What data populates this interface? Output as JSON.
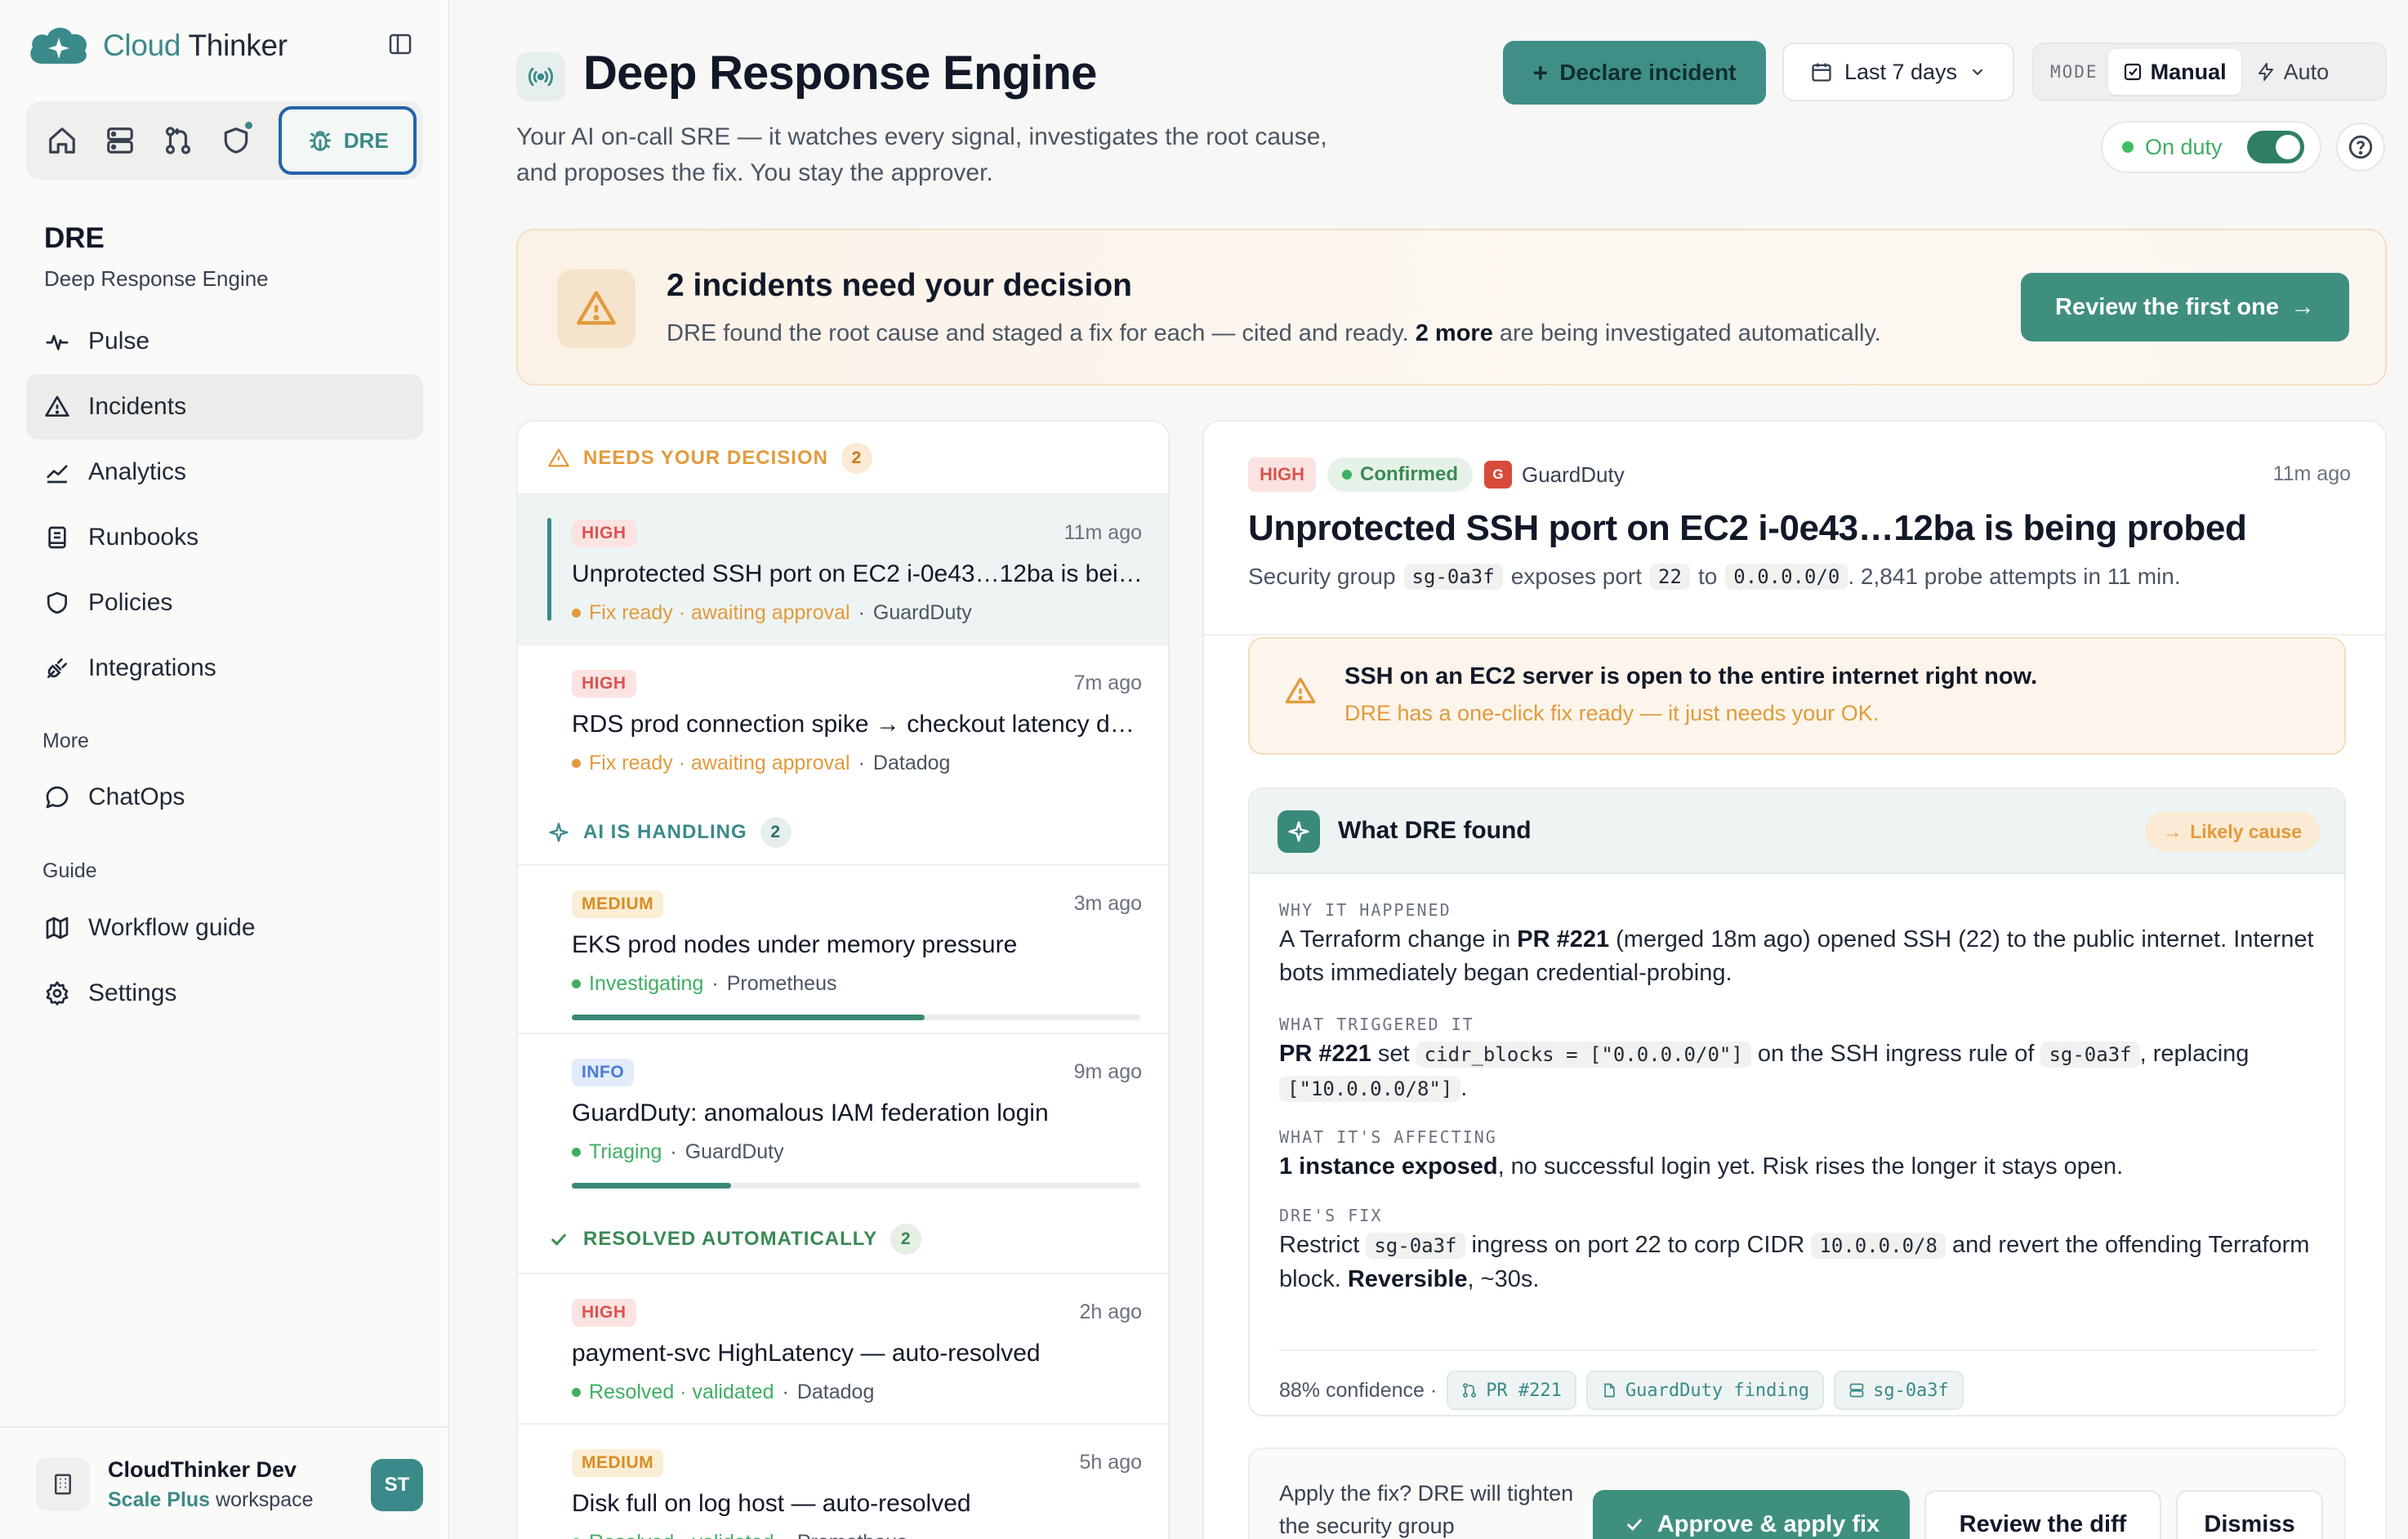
{
  "brand": {
    "part1": "Cloud",
    "part2": " Thinker"
  },
  "sidebar": {
    "dre_label": "DRE",
    "title": "DRE",
    "subtitle": "Deep Response Engine",
    "nav": [
      {
        "label": "Pulse",
        "icon": "pulse-icon"
      },
      {
        "label": "Incidents",
        "icon": "alert-triangle-icon",
        "active": true
      },
      {
        "label": "Analytics",
        "icon": "chart-icon"
      },
      {
        "label": "Runbooks",
        "icon": "book-icon"
      },
      {
        "label": "Policies",
        "icon": "shield-icon"
      },
      {
        "label": "Integrations",
        "icon": "plug-icon"
      }
    ],
    "more_label": "More",
    "more_items": [
      {
        "label": "ChatOps",
        "icon": "chat-icon"
      }
    ],
    "guide_label": "Guide",
    "guide_items": [
      {
        "label": "Workflow guide",
        "icon": "map-icon"
      },
      {
        "label": "Settings",
        "icon": "gear-icon"
      }
    ],
    "workspace": {
      "name": "CloudThinker Dev",
      "plan": "Scale Plus",
      "suffix": " workspace",
      "avatar": "ST"
    }
  },
  "header": {
    "title": "Deep Response Engine",
    "description": "Your AI on-call SRE — it watches every signal, investigates the root cause, and proposes the fix. You stay the approver.",
    "declare_label": "Declare incident",
    "range_label": "Last 7 days",
    "mode_label": "MODE",
    "mode_manual": "Manual",
    "mode_auto": "Auto",
    "onduty_label": "On duty"
  },
  "banner": {
    "title": "2 incidents need your decision",
    "text_pre": "DRE found the root cause and staged a fix for each — cited and ready. ",
    "text_bold": "2 more",
    "text_post": " are being investigated automatically.",
    "button": "Review the first one"
  },
  "list": {
    "sections": [
      {
        "label": "NEEDS YOUR DECISION",
        "count": "2"
      },
      {
        "label": "AI IS HANDLING",
        "count": "2"
      },
      {
        "label": "RESOLVED AUTOMATICALLY",
        "count": "2"
      }
    ],
    "incidents": [
      {
        "severity": "HIGH",
        "time": "11m ago",
        "title": "Unprotected SSH port on EC2 i-0e43…12ba is being probed",
        "status": "Fix ready · awaiting approval",
        "source": "GuardDuty"
      },
      {
        "severity": "HIGH",
        "time": "7m ago",
        "title": "RDS prod connection spike → checkout latency degraded",
        "status": "Fix ready · awaiting approval",
        "source": "Datadog"
      },
      {
        "severity": "MEDIUM",
        "time": "3m ago",
        "title": "EKS prod nodes under memory pressure",
        "status": "Investigating",
        "source": "Prometheus",
        "progress": 0.62
      },
      {
        "severity": "INFO",
        "time": "9m ago",
        "title": "GuardDuty: anomalous IAM federation login",
        "status": "Triaging",
        "source": "GuardDuty",
        "progress": 0.28
      },
      {
        "severity": "HIGH",
        "time": "2h ago",
        "title": "payment-svc HighLatency — auto-resolved",
        "status": "Resolved · validated",
        "source": "Datadog"
      },
      {
        "severity": "MEDIUM",
        "time": "5h ago",
        "title": "Disk full on log host — auto-resolved",
        "status": "Resolved · validated",
        "source": "Prometheus"
      }
    ]
  },
  "detail": {
    "severity": "HIGH",
    "state": "Confirmed",
    "source_logo": "G",
    "source": "GuardDuty",
    "time": "11m ago",
    "title": "Unprotected SSH port on EC2 i-0e43…12ba is being probed",
    "sub": {
      "p1": "Security group",
      "sg": "sg-0a3f",
      "p2": "exposes port",
      "port": "22",
      "p3": "to",
      "cidr": "0.0.0.0/0",
      "p4": ". 2,841 probe attempts in 11 min."
    },
    "alert_title": "SSH on an EC2 server is open to the entire internet right now.",
    "alert_sub": "DRE has a one-click fix ready — it just needs your OK.",
    "found": {
      "title": "What DRE found",
      "badge": "Likely cause",
      "why_label": "WHY IT HAPPENED",
      "why_pre": "A Terraform change in ",
      "why_pr": "PR #221",
      "why_post": " (merged 18m ago) opened SSH (22) to the public internet. Internet bots immediately began credential-probing.",
      "trigger_label": "WHAT TRIGGERED IT",
      "trigger_pr": "PR #221",
      "trigger_set": " set ",
      "trigger_code1": "cidr_blocks = [\"0.0.0.0/0\"]",
      "trigger_mid": " on the SSH ingress rule of ",
      "trigger_code2": "sg-0a3f",
      "trigger_replacing": ", replacing ",
      "trigger_code3": "[\"10.0.0.0/8\"]",
      "trigger_end": ".",
      "affect_label": "WHAT IT'S AFFECTING",
      "affect_bold": "1 instance exposed",
      "affect_post": ", no successful login yet. Risk rises the longer it stays open.",
      "fix_label": "DRE'S FIX",
      "fix_pre": "Restrict ",
      "fix_code1": "sg-0a3f",
      "fix_mid": " ingress on port 22 to corp CIDR ",
      "fix_code2": "10.0.0.0/8",
      "fix_post": " and revert the offending Terraform block. ",
      "fix_bold": "Reversible",
      "fix_end": ", ~30s.",
      "confidence": "88% confidence ·",
      "cites": [
        "PR #221",
        "GuardDuty finding",
        "sg-0a3f"
      ]
    },
    "apply": {
      "text": "Apply the fix? DRE will tighten the security group",
      "approve": "Approve & apply fix",
      "diff": "Review the diff",
      "dismiss": "Dismiss"
    }
  },
  "colors": {
    "accent": "#3a8a89",
    "warn": "#e29a3c",
    "high": "#d9534f",
    "ok": "#3fae62"
  }
}
